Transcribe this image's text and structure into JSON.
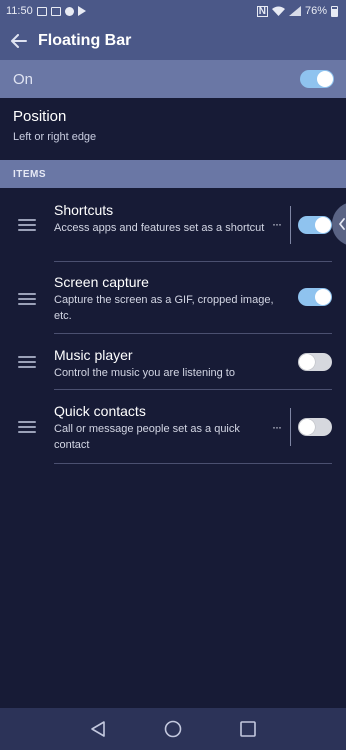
{
  "status_bar": {
    "time": "11:50",
    "battery": "76%",
    "left_icons": [
      "gmail-icon",
      "image-icon",
      "circle-icon",
      "play-icon"
    ],
    "right_icons": [
      "nfc-icon",
      "wifi-icon",
      "signal-icon",
      "battery-icon"
    ]
  },
  "app_bar": {
    "title": "Floating Bar",
    "back_icon": "back-arrow-icon"
  },
  "on_row": {
    "label": "On",
    "enabled": true
  },
  "position": {
    "title": "Position",
    "subtitle": "Left or right edge"
  },
  "items_section": {
    "header": "ITEMS",
    "items": [
      {
        "title": "Shortcuts",
        "description": "Access apps and features set as a shortcut",
        "enabled": true,
        "has_more": true
      },
      {
        "title": "Screen capture",
        "description": "Capture the screen as a GIF, cropped image, etc.",
        "enabled": true,
        "has_more": false
      },
      {
        "title": "Music player",
        "description": "Control the music you are listening to",
        "enabled": false,
        "has_more": false
      },
      {
        "title": "Quick contacts",
        "description": "Call or message people set as a quick contact",
        "enabled": false,
        "has_more": true
      }
    ]
  },
  "more_label": "···",
  "nav_bar": {
    "buttons": [
      "back-triangle-icon",
      "home-circle-icon",
      "recents-square-icon"
    ]
  },
  "colors": {
    "background": "#171b36",
    "app_bar": "#4b5888",
    "highlight_row": "#6a77a5",
    "toggle_on": "#8fc3ef",
    "toggle_off": "#d6d8de"
  }
}
